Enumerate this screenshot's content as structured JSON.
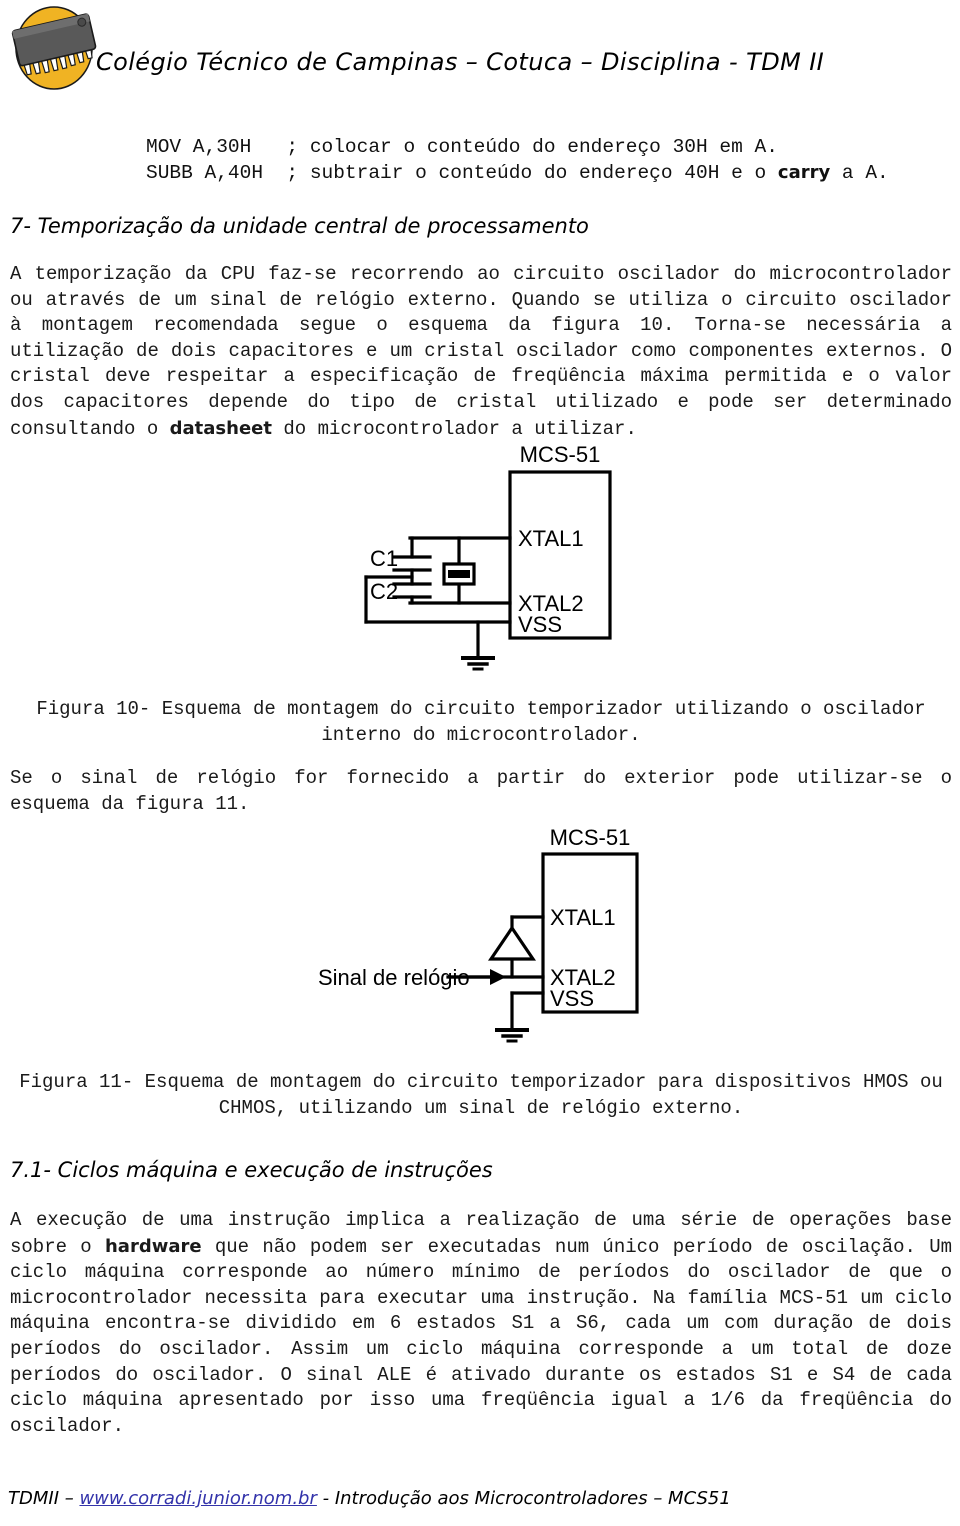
{
  "header": {
    "title": "Colégio Técnico de Campinas – Cotuca – Disciplina - TDM II",
    "logo_name": "cotuca-chip-logo"
  },
  "code_listing": {
    "line1": "MOV A,30H   ; colocar o conteúdo do endereço 30H em A.",
    "line2_before": "SUBB A,40H  ; subtrair o conteúdo do endereço 40H e o ",
    "line2_bold": "carry",
    "line2_after": " a A."
  },
  "section7": {
    "title": "7- Temporização da unidade central de processamento",
    "paragraph_before": "A temporização da CPU faz-se recorrendo ao circuito oscilador do microcontrolador ou através de um sinal de relógio externo. Quando se utiliza o circuito oscilador à montagem recomendada segue o esquema da figura 10. Torna-se necessária a utilização de dois capacitores e um cristal oscilador como componentes externos. O cristal deve respeitar a especificação de freqüência máxima permitida e o valor dos capacitores depende do tipo de cristal utilizado e pode ser determinado consultando o ",
    "paragraph_bold": "datasheet",
    "paragraph_after": " do microcontrolador a utilizar."
  },
  "figure10": {
    "chip_label": "MCS-51",
    "pin_xtal1": "XTAL1",
    "pin_xtal2": "XTAL2",
    "pin_vss": "VSS",
    "cap1_label": "C1",
    "cap2_label": "C2",
    "caption": "Figura 10- Esquema de montagem do circuito temporizador utilizando o oscilador interno do microcontrolador."
  },
  "figure11": {
    "chip_label": "MCS-51",
    "pin_xtal1": "XTAL1",
    "pin_xtal2": "XTAL2",
    "pin_vss": "VSS",
    "input_label": "Sinal de relógio",
    "caption": "Figura 11- Esquema de montagem do circuito temporizador para dispositivos HMOS ou CHMOS, utilizando um sinal de relógio externo."
  },
  "between_figures": {
    "text": "Se o sinal de relógio for fornecido a partir do exterior pode utilizar-se o esquema da figura 11."
  },
  "section71": {
    "title": "7.1- Ciclos máquina e execução de instruções",
    "par_a": "A execução de uma instrução implica a realização de uma série de operações base sobre o ",
    "par_bold1": "hardware",
    "par_b": " que não podem ser executadas num único período de oscilação. Um ciclo máquina corresponde ao número mínimo de períodos do oscilador de que o microcontrolador necessita para executar uma instrução. Na família MCS-51 um ciclo máquina encontra-se dividido em 6 estados S1 a S6, cada um com duração de dois períodos do oscilador. Assim um ciclo máquina corresponde a um total de doze períodos do oscilador. O sinal ALE é ativado durante os estados S1 e S4 de cada ciclo máquina apresentado por isso uma freqüência igual a 1/6 da freqüência do oscilador."
  },
  "footer": {
    "prefix": "TDMII – ",
    "link": "www.corradi.junior.nom.br",
    "suffix": " - Introdução aos Microcontroladores – MCS51"
  },
  "colors": {
    "logo_circle": "#f0b323",
    "logo_chip": "#595959",
    "link": "#3333aa",
    "text": "#1a1a1a"
  }
}
